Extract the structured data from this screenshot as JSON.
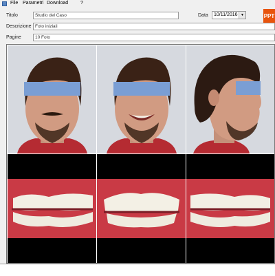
{
  "menu": {
    "items": [
      "File",
      "Parametri",
      "Download",
      "?"
    ]
  },
  "form": {
    "title_label": "Titolo",
    "title_value": "Studio del Caso",
    "date_label": "Data",
    "date_value": "10/11/2016",
    "description_label": "Descrizione",
    "description_value": "Foto iniziali",
    "page_label": "Pagine",
    "page_value": "10 Foto"
  },
  "brand": {
    "label": "PPT",
    "color": "#e8540d"
  },
  "photos": {
    "row1": [
      "face-front-neutral",
      "face-front-smile",
      "face-profile-right"
    ],
    "row2": [
      "intraoral-right",
      "intraoral-front",
      "intraoral-left"
    ]
  },
  "colors": {
    "privacy_bar": "#7a9ed4",
    "background": "#f0f0f0"
  }
}
